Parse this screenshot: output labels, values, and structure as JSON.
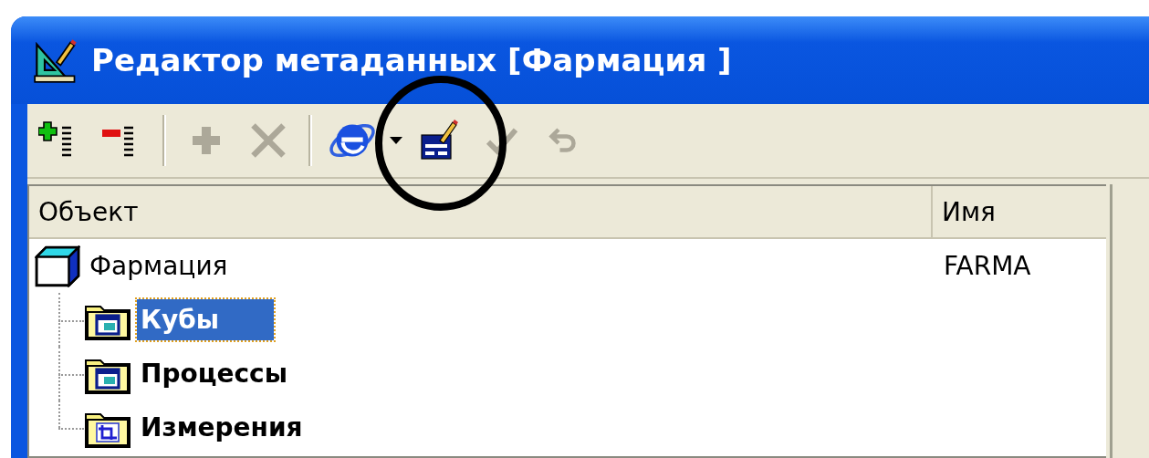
{
  "window": {
    "title": "Редактор метаданных [Фармация ]"
  },
  "toolbar": [
    {
      "kind": "add-row",
      "disabled": false
    },
    {
      "kind": "remove-row",
      "disabled": false
    },
    {
      "kind": "separator"
    },
    {
      "kind": "plus",
      "disabled": true
    },
    {
      "kind": "delete",
      "disabled": true
    },
    {
      "kind": "separator"
    },
    {
      "kind": "browser",
      "disabled": false
    },
    {
      "kind": "dropdown",
      "disabled": false
    },
    {
      "kind": "edit-form",
      "disabled": false
    },
    {
      "kind": "check",
      "disabled": true
    },
    {
      "kind": "undo",
      "disabled": true
    }
  ],
  "table": {
    "columns": [
      "Объект",
      "Имя"
    ],
    "tree": [
      {
        "label": "Фармация",
        "name": "FARMA",
        "selected": false,
        "kind": "cube",
        "children": [
          {
            "label": "Кубы",
            "selected": true,
            "kind": "folder-form"
          },
          {
            "label": "Процессы",
            "selected": false,
            "kind": "folder-form"
          },
          {
            "label": "Измерения",
            "selected": false,
            "kind": "folder-axes"
          }
        ]
      }
    ]
  }
}
